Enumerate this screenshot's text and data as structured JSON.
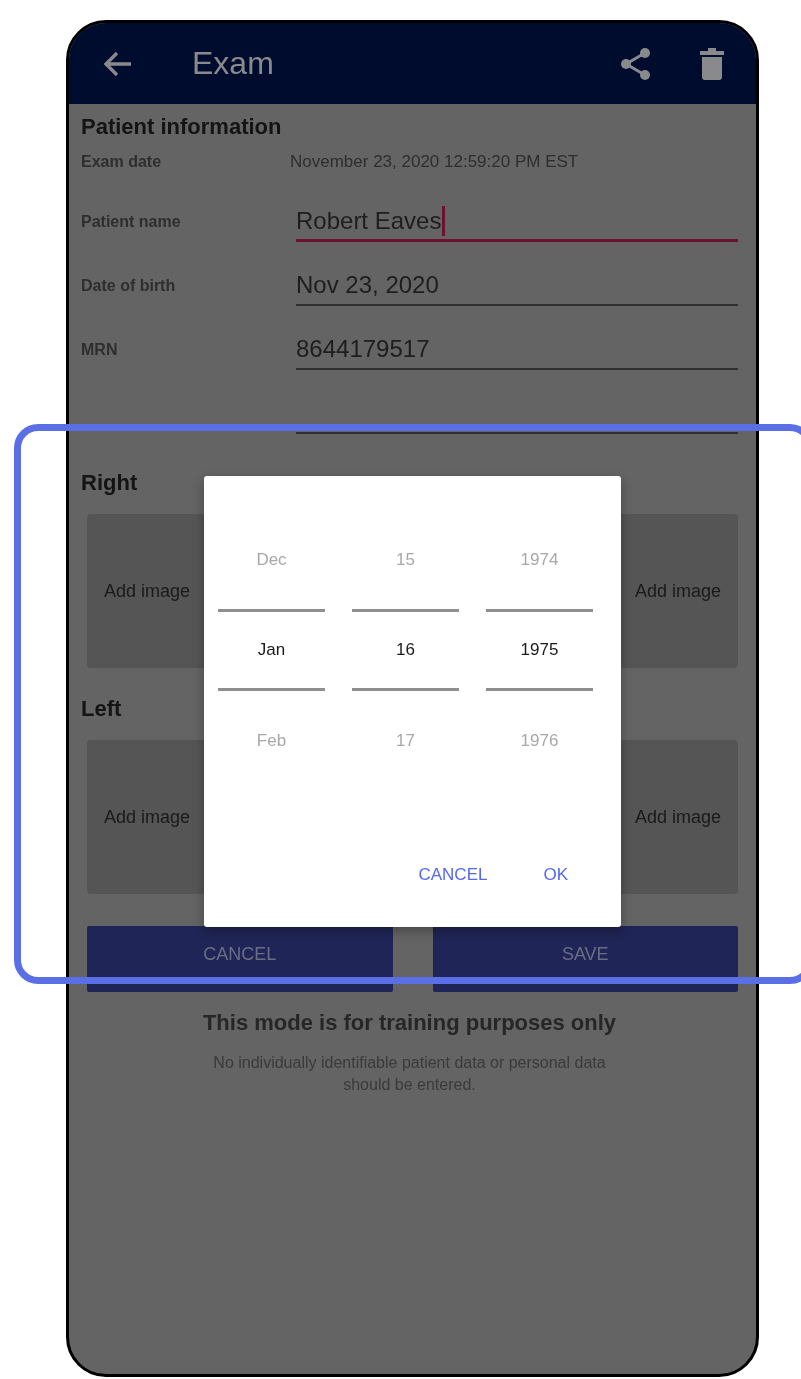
{
  "header": {
    "title": "Exam"
  },
  "patient_information": {
    "title": "Patient information",
    "exam_date": {
      "label": "Exam date",
      "value": "November 23, 2020 12:59:20 PM EST"
    },
    "fields": [
      {
        "label": "Patient name",
        "value": "Robert Eaves",
        "focused": true
      },
      {
        "label": "Date of birth",
        "value": "Nov 23, 2020",
        "focused": false
      },
      {
        "label": "MRN",
        "value": "8644179517",
        "focused": false
      },
      {
        "focused": false
      }
    ]
  },
  "image_sections": [
    {
      "title": "Right",
      "tiles": [
        "Add image",
        "Add image"
      ]
    },
    {
      "title": "Left",
      "tiles": [
        "Add image",
        "Add image"
      ]
    }
  ],
  "form_buttons": [
    {
      "label": "CANCEL"
    },
    {
      "label": "SAVE"
    }
  ],
  "notice": {
    "title": "This mode is for training purposes only",
    "text": "No individually identifiable patient data or personal data should be entered."
  },
  "date_picker": {
    "columns": [
      {
        "items": [
          {
            "label": "Dec",
            "selected": false
          },
          {
            "label": "Jan",
            "selected": true
          },
          {
            "label": "Feb",
            "selected": false
          }
        ]
      },
      {
        "items": [
          {
            "label": "15",
            "selected": false
          },
          {
            "label": "16",
            "selected": true
          },
          {
            "label": "17",
            "selected": false
          }
        ]
      },
      {
        "items": [
          {
            "label": "1974",
            "selected": false
          },
          {
            "label": "1975",
            "selected": true
          },
          {
            "label": "1976",
            "selected": false
          }
        ]
      }
    ],
    "buttons": [
      {
        "label": "CANCEL"
      },
      {
        "label": "OK"
      }
    ]
  }
}
